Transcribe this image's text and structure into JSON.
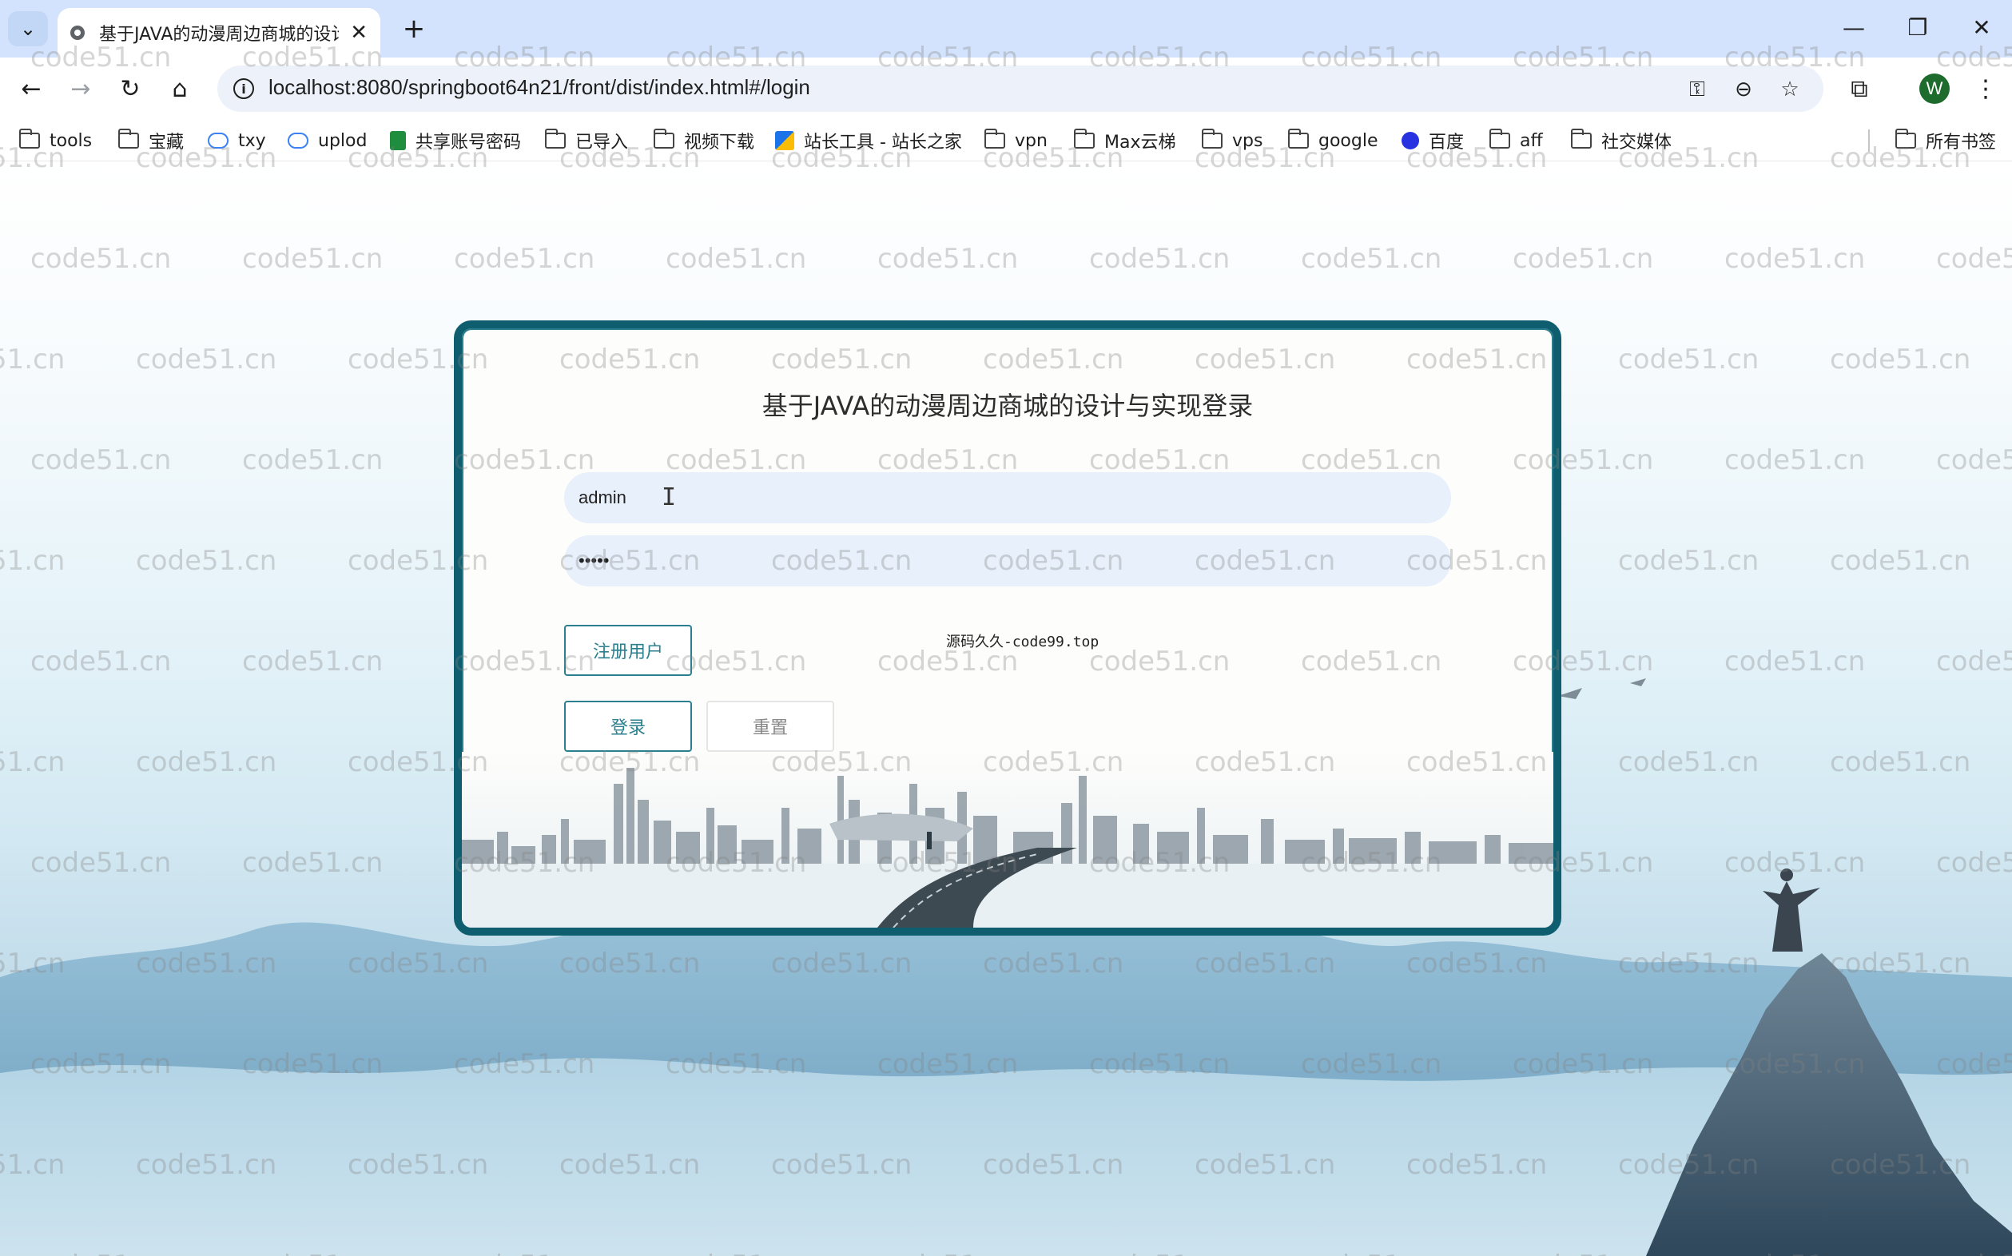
{
  "browser": {
    "tab_title": "基于JAVA的动漫周边商城的设计",
    "url": "localhost:8080/springboot64n21/front/dist/index.html#/login",
    "profile_initial": "W",
    "bookmarks": [
      {
        "label": "tools",
        "icon": "folder-icon"
      },
      {
        "label": "宝藏",
        "icon": "folder-icon"
      },
      {
        "label": "txy",
        "icon": "cloud-icon"
      },
      {
        "label": "uplod",
        "icon": "cloud-icon"
      },
      {
        "label": "共享账号密码",
        "icon": "sheet-icon"
      },
      {
        "label": "已导入",
        "icon": "folder-icon"
      },
      {
        "label": "视频下载",
        "icon": "folder-icon"
      },
      {
        "label": "站长工具 - 站长之家",
        "icon": "tool-icon"
      },
      {
        "label": "vpn",
        "icon": "folder-icon"
      },
      {
        "label": "Max云梯",
        "icon": "folder-icon"
      },
      {
        "label": "vps",
        "icon": "folder-icon"
      },
      {
        "label": "google",
        "icon": "folder-icon"
      },
      {
        "label": "百度",
        "icon": "baidu-icon"
      },
      {
        "label": "aff",
        "icon": "folder-icon"
      },
      {
        "label": "社交媒体",
        "icon": "folder-icon"
      }
    ],
    "all_bookmarks": "所有书签"
  },
  "login": {
    "title": "基于JAVA的动漫周边商城的设计与实现登录",
    "username_value": "admin",
    "password_value": "•••••",
    "register_button": "注册用户",
    "login_button": "登录",
    "reset_button": "重置",
    "source_note": "源码久久-code99.top",
    "accent_color": "#0e5e6f"
  },
  "watermark_text": "code51.cn"
}
